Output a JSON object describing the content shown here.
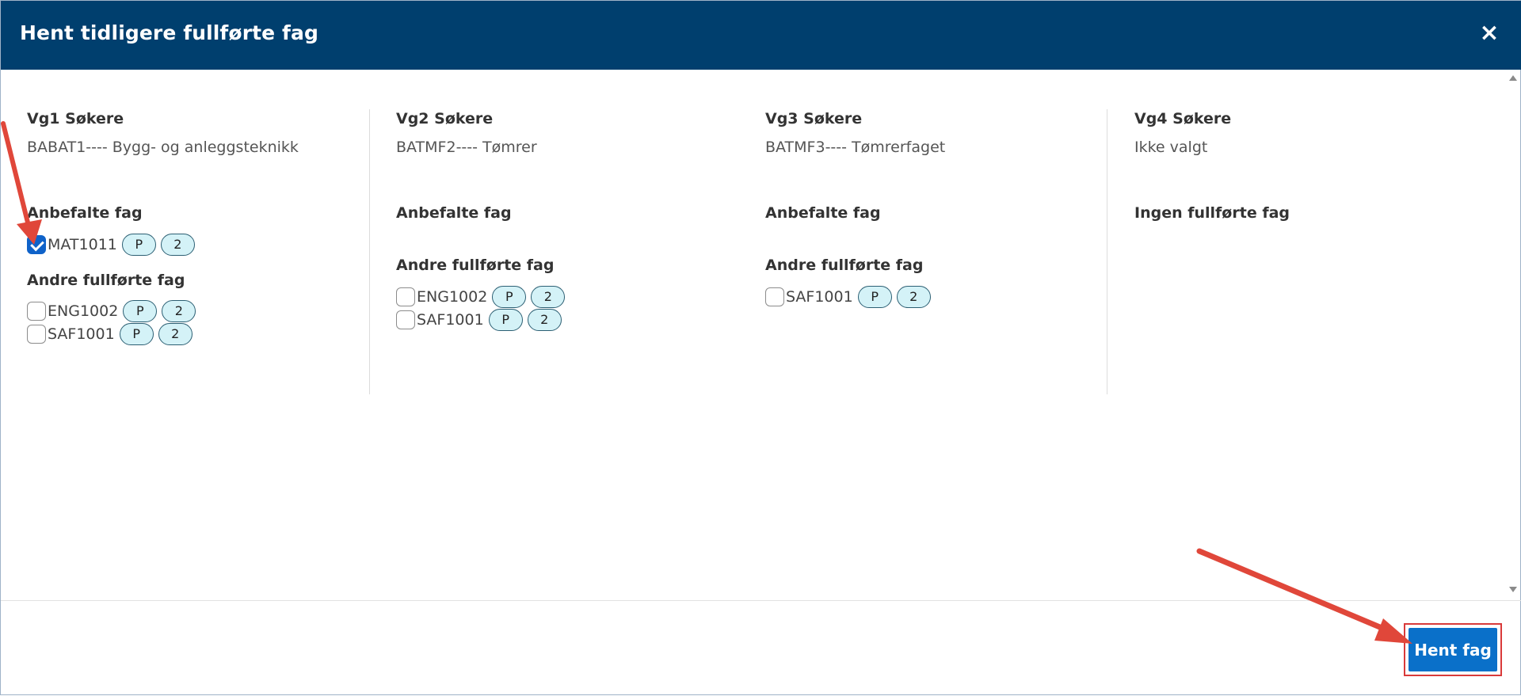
{
  "dialog": {
    "title": "Hent tidligere fullførte fag",
    "close_label": "×"
  },
  "columns": [
    {
      "title": "Vg1 Søkere",
      "program": "BABAT1---- Bygg- og anleggsteknikk",
      "recommended_heading": "Anbefalte fag",
      "recommended": [
        {
          "code": "MAT1011",
          "badges": [
            "P",
            "2"
          ],
          "checked": true
        }
      ],
      "other_heading": "Andre fullførte fag",
      "other": [
        {
          "code": "ENG1002",
          "badges": [
            "P",
            "2"
          ],
          "checked": false
        },
        {
          "code": "SAF1001",
          "badges": [
            "P",
            "2"
          ],
          "checked": false
        }
      ]
    },
    {
      "title": "Vg2 Søkere",
      "program": "BATMF2---- Tømrer",
      "recommended_heading": "Anbefalte fag",
      "other_heading": "Andre fullførte fag",
      "other": [
        {
          "code": "ENG1002",
          "badges": [
            "P",
            "2"
          ],
          "checked": false
        },
        {
          "code": "SAF1001",
          "badges": [
            "P",
            "2"
          ],
          "checked": false
        }
      ]
    },
    {
      "title": "Vg3 Søkere",
      "program": "BATMF3---- Tømrerfaget",
      "recommended_heading": "Anbefalte fag",
      "other_heading": "Andre fullførte fag",
      "other": [
        {
          "code": "SAF1001",
          "badges": [
            "P",
            "2"
          ],
          "checked": false
        }
      ]
    },
    {
      "title": "Vg4 Søkere",
      "program": "Ikke valgt",
      "empty_heading": "Ingen fullførte fag"
    }
  ],
  "footer": {
    "submit_label": "Hent fag"
  },
  "colors": {
    "header": "#003f6e",
    "button": "#0a70c9",
    "checkbox_checked": "#0f62c9",
    "badge_bg": "#d4f2f7",
    "annotation_arrow": "#e0473a"
  },
  "icons": [
    "close-icon",
    "checkmark-icon",
    "annotation-arrow-icon"
  ]
}
